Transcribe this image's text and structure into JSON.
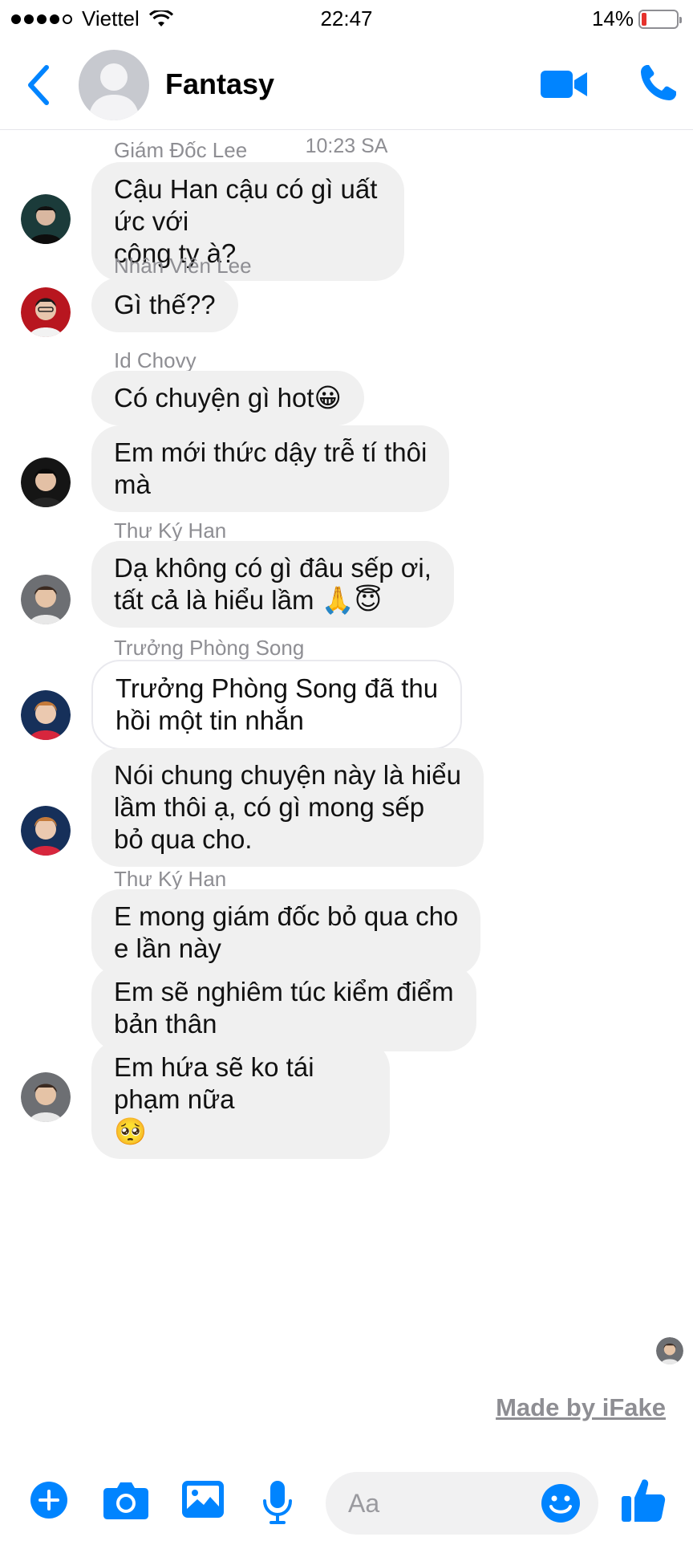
{
  "status_bar": {
    "carrier": "Viettel",
    "time": "22:47",
    "battery_percent": "14%",
    "battery_level": 0.14,
    "signal_bars": 4,
    "signal_max": 5
  },
  "header": {
    "title": "Fantasy",
    "icons": {
      "back": "chevron-left-icon",
      "video": "video-camera-icon",
      "call": "phone-icon"
    }
  },
  "conversation": {
    "timestamp": "10:23 SA",
    "messages": [
      {
        "sender": "Giám Đốc Lee",
        "lines": [
          "Cậu Han cậu có gì uất ức với",
          "công ty à?"
        ]
      },
      {
        "sender": "Nhân Viên Lee",
        "lines": [
          "Gì thế??"
        ]
      },
      {
        "sender": "Id Chovy",
        "lines": [
          "Có chuyện gì hot"
        ]
      },
      {
        "lines": [
          "Em mới thức dậy trễ tí thôi",
          "mà"
        ]
      },
      {
        "sender": "Thư Ký Han",
        "lines": [
          "Dạ không có gì đâu sếp ơi,",
          "tất cả là hiểu lầm "
        ]
      },
      {
        "sender": "Trưởng Phòng Song",
        "lines": [
          "Trưởng Phòng Song đã thu",
          "hồi một tin nhắn"
        ]
      },
      {
        "lines": [
          "Nói chung chuyện này là hiểu",
          "lầm thôi ạ, có gì mong sếp",
          "bỏ qua cho."
        ]
      },
      {
        "sender": "Thư Ký Han",
        "lines": [
          "E mong giám đốc bỏ qua cho",
          "e lần này"
        ]
      },
      {
        "lines": [
          "Em sẽ nghiêm túc kiểm điểm",
          "bản thân"
        ]
      },
      {
        "lines": [
          "Em hứa sẽ ko tái phạm nữa"
        ]
      }
    ],
    "emojis": {
      "grin": "😀",
      "pray": "🙏",
      "halo": "😇",
      "pleading": "🥺"
    }
  },
  "watermark": "Made by iFake",
  "composer": {
    "placeholder": "Aa",
    "icons": [
      "plus-icon",
      "camera-icon",
      "image-icon",
      "microphone-icon",
      "emoji-icon",
      "thumbs-up-icon"
    ]
  },
  "colors": {
    "accent": "#0084ff",
    "bubble": "#f0f0f0",
    "secondary_text": "#8e8e93",
    "battery_low": "#e5322d"
  }
}
